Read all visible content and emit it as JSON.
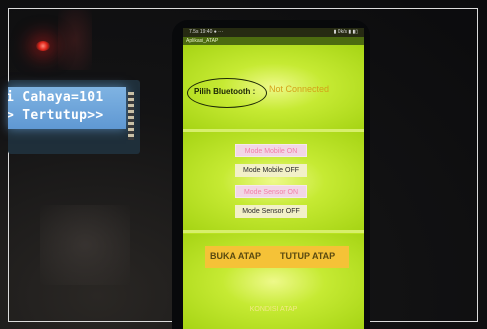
{
  "lcd": {
    "line1": "i Cahaya=101",
    "line2": "> Tertutup>>"
  },
  "phone": {
    "status_left": "7.5s 19:40 ●  ···",
    "status_right": "▮ 0k/s ▮ ▮▯",
    "app_title": "Aplikasi_ATAP",
    "bluetooth_button": "Pilih Bluetooth :",
    "bluetooth_status": "Not Connected",
    "mode_mobile_on": "Mode Mobile ON",
    "mode_mobile_off": "Mode Mobile OFF",
    "mode_sensor_on": "Mode Sensor ON",
    "mode_sensor_off": "Mode Sensor OFF",
    "buka_atap": "BUKA ATAP",
    "tutup_atap": "TUTUP ATAP",
    "kondisi_atap": "KONDISI ATAP"
  },
  "colors": {
    "screen_green": "#b9e21e",
    "button_orange": "#f5c237",
    "lcd_blue": "#6aa4d9",
    "led_red": "#e0261b"
  }
}
